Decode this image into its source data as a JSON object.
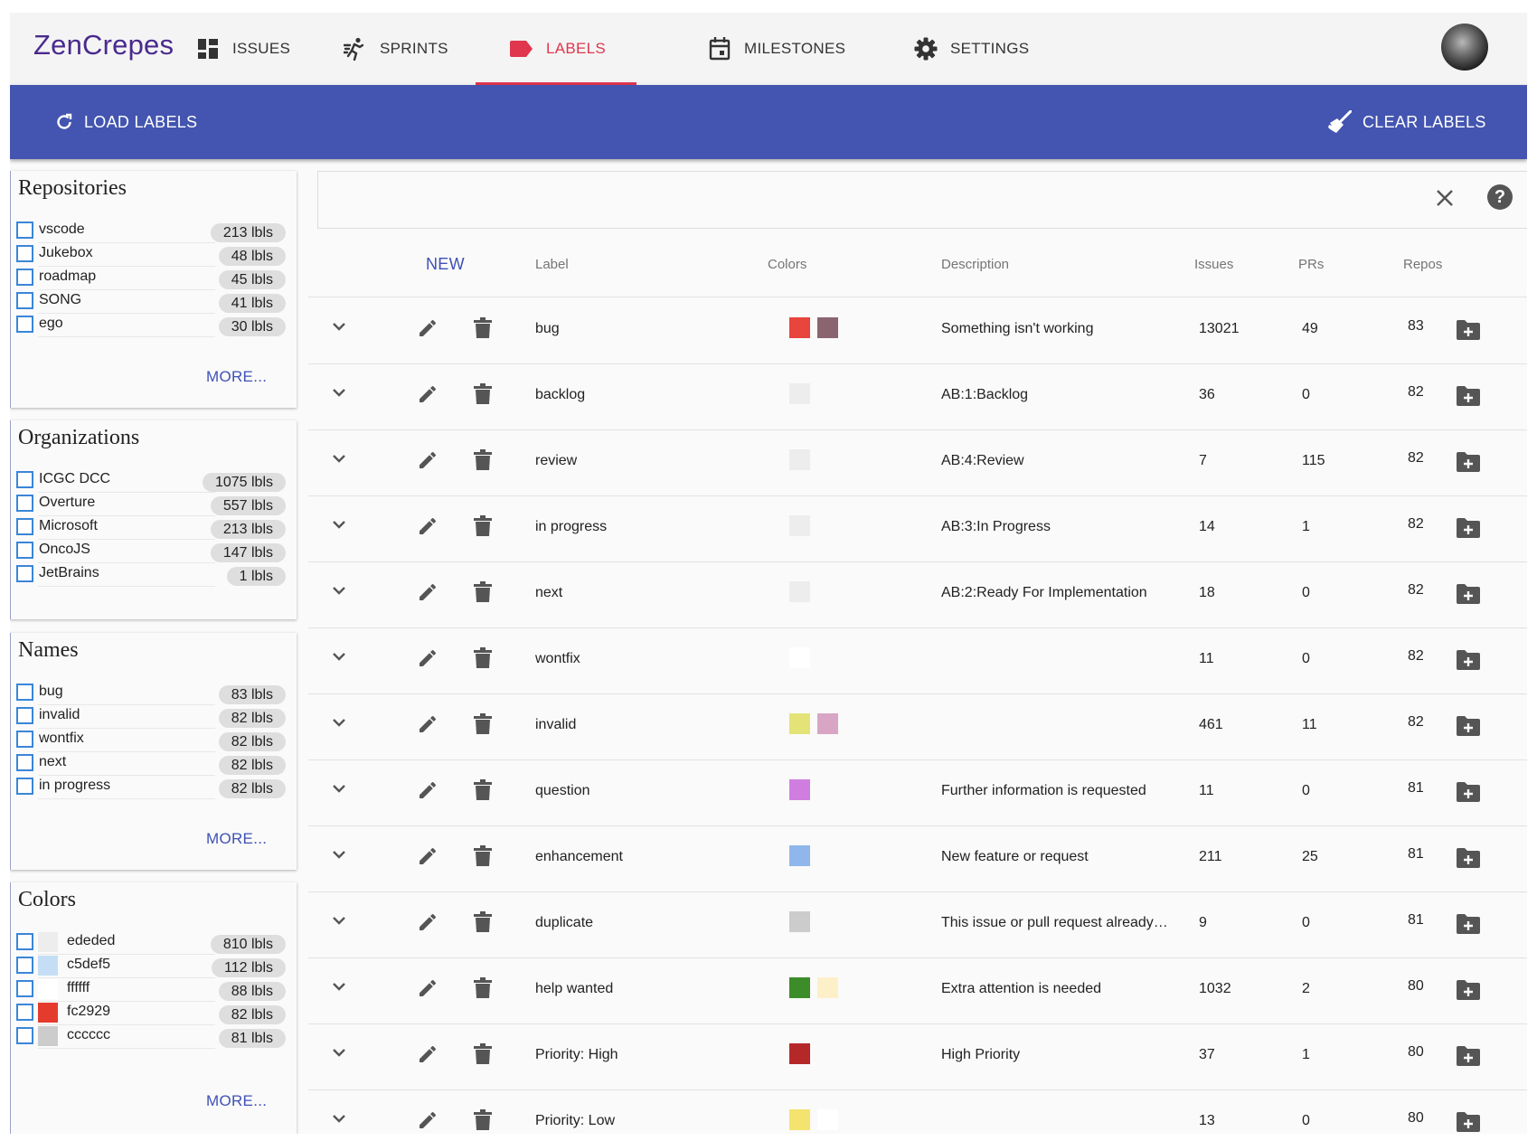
{
  "app": {
    "logo": "ZenCrepes"
  },
  "nav": {
    "tabs": [
      {
        "label": "ISSUES"
      },
      {
        "label": "SPRINTS"
      },
      {
        "label": "LABELS"
      },
      {
        "label": "MILESTONES"
      },
      {
        "label": "SETTINGS"
      }
    ],
    "active": "LABELS"
  },
  "toolbar": {
    "load_label": "LOAD LABELS",
    "clear_label": "CLEAR LABELS"
  },
  "sidebar": {
    "repositories": {
      "title": "Repositories",
      "items": [
        {
          "name": "vscode",
          "count": "213 lbls"
        },
        {
          "name": "Jukebox",
          "count": "48 lbls"
        },
        {
          "name": "roadmap",
          "count": "45 lbls"
        },
        {
          "name": "SONG",
          "count": "41 lbls"
        },
        {
          "name": "ego",
          "count": "30 lbls"
        }
      ],
      "more": "MORE..."
    },
    "organizations": {
      "title": "Organizations",
      "items": [
        {
          "name": "ICGC DCC",
          "count": "1075 lbls"
        },
        {
          "name": "Overture",
          "count": "557 lbls"
        },
        {
          "name": "Microsoft",
          "count": "213 lbls"
        },
        {
          "name": "OncoJS",
          "count": "147 lbls"
        },
        {
          "name": "JetBrains",
          "count": "1 lbls"
        }
      ]
    },
    "names": {
      "title": "Names",
      "items": [
        {
          "name": "bug",
          "count": "83 lbls"
        },
        {
          "name": "invalid",
          "count": "82 lbls"
        },
        {
          "name": "wontfix",
          "count": "82 lbls"
        },
        {
          "name": "next",
          "count": "82 lbls"
        },
        {
          "name": "in progress",
          "count": "82 lbls"
        }
      ],
      "more": "MORE..."
    },
    "colors": {
      "title": "Colors",
      "items": [
        {
          "name": "ededed",
          "count": "810 lbls",
          "swatch": "#ededed"
        },
        {
          "name": "c5def5",
          "count": "112 lbls",
          "swatch": "#c5def5"
        },
        {
          "name": "ffffff",
          "count": "88 lbls",
          "swatch": "#ffffff"
        },
        {
          "name": "fc2929",
          "count": "82 lbls",
          "swatch": "#fc2929"
        },
        {
          "name": "cccccc",
          "count": "81 lbls",
          "swatch": "#cccccc"
        }
      ],
      "more": "MORE..."
    }
  },
  "table": {
    "new_label": "NEW",
    "headers": {
      "label": "Label",
      "colors": "Colors",
      "description": "Description",
      "issues": "Issues",
      "prs": "PRs",
      "repos": "Repos"
    },
    "rows": [
      {
        "label": "bug",
        "colors": [
          "#e8453c",
          "#8a6570"
        ],
        "description": "Something isn't working",
        "issues": "13021",
        "prs": "49",
        "repos": "83"
      },
      {
        "label": "backlog",
        "colors": [
          "#ededed"
        ],
        "description": "AB:1:Backlog",
        "issues": "36",
        "prs": "0",
        "repos": "82"
      },
      {
        "label": "review",
        "colors": [
          "#ededed"
        ],
        "description": "AB:4:Review",
        "issues": "7",
        "prs": "115",
        "repos": "82"
      },
      {
        "label": "in progress",
        "colors": [
          "#ededed"
        ],
        "description": "AB:3:In Progress",
        "issues": "14",
        "prs": "1",
        "repos": "82"
      },
      {
        "label": "next",
        "colors": [
          "#ededed"
        ],
        "description": "AB:2:Ready For Implementation",
        "issues": "18",
        "prs": "0",
        "repos": "82"
      },
      {
        "label": "wontfix",
        "colors": [
          "#ffffff"
        ],
        "description": "",
        "issues": "11",
        "prs": "0",
        "repos": "82"
      },
      {
        "label": "invalid",
        "colors": [
          "#e4e377",
          "#d9a5c4"
        ],
        "description": "",
        "issues": "461",
        "prs": "11",
        "repos": "82"
      },
      {
        "label": "question",
        "colors": [
          "#cf7ee0"
        ],
        "description": "Further information is requested",
        "issues": "11",
        "prs": "0",
        "repos": "81"
      },
      {
        "label": "enhancement",
        "colors": [
          "#8fb7ec"
        ],
        "description": "New feature or request",
        "issues": "211",
        "prs": "25",
        "repos": "81"
      },
      {
        "label": "duplicate",
        "colors": [
          "#cccccc"
        ],
        "description": "This issue or pull request already exists",
        "issues": "9",
        "prs": "0",
        "repos": "81"
      },
      {
        "label": "help wanted",
        "colors": [
          "#3c8c2a",
          "#fdf0c9"
        ],
        "description": "Extra attention is needed",
        "issues": "1032",
        "prs": "2",
        "repos": "80"
      },
      {
        "label": "Priority: High",
        "colors": [
          "#b5282a"
        ],
        "description": "High Priority",
        "issues": "37",
        "prs": "1",
        "repos": "80"
      },
      {
        "label": "Priority: Low",
        "colors": [
          "#f4e36e",
          "#ffffff"
        ],
        "description": "",
        "issues": "13",
        "prs": "0",
        "repos": "80"
      }
    ]
  },
  "theme": {
    "primary": "#4355b0",
    "accent": "#e0364e",
    "logo_color": "#4a2a8e",
    "checkbox": "#3a86d8"
  },
  "icons": {
    "row": [
      "chevron-down-icon",
      "pencil-icon",
      "trash-icon",
      "folder-add-icon"
    ],
    "toolbar": [
      "refresh-icon",
      "broom-icon"
    ],
    "search": [
      "close-icon",
      "help-icon"
    ]
  }
}
